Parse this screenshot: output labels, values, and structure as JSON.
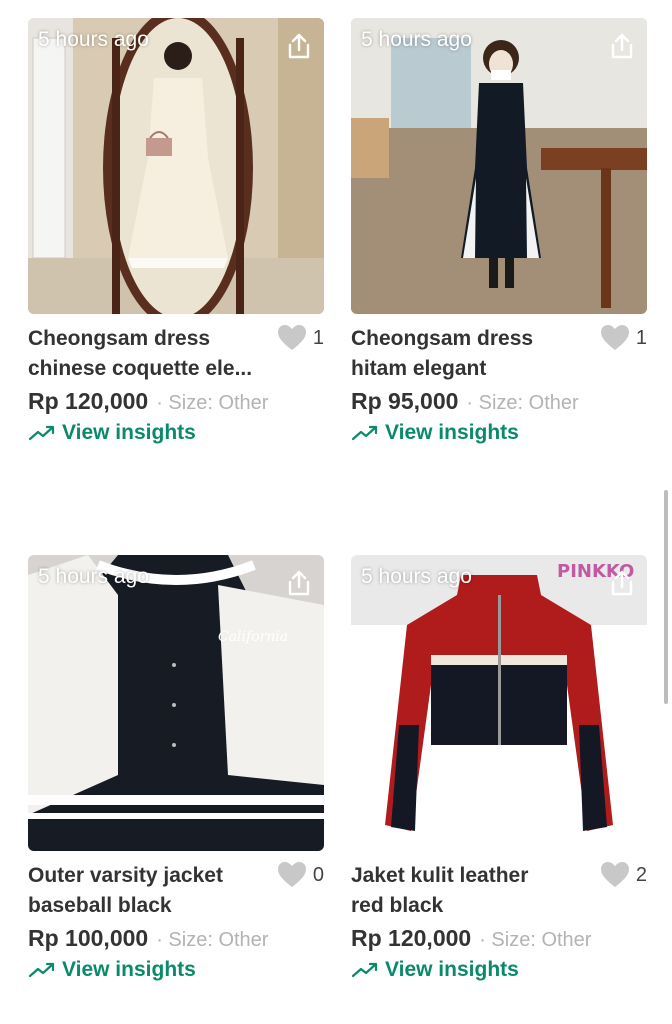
{
  "colors": {
    "accent": "#0b8a6b",
    "text": "#333333",
    "muted": "#b3b3b3",
    "heart": "#c8c8c8"
  },
  "products": [
    {
      "time": "5 hours ago",
      "title_line1": "Cheongsam dress",
      "title_line2": "chinese coquette ele...",
      "likes": "1",
      "price": "Rp 120,000",
      "size": "· Size: Other",
      "insights": "View insights"
    },
    {
      "time": "5 hours ago",
      "title_line1": "Cheongsam dress",
      "title_line2": "hitam elegant",
      "likes": "1",
      "price": "Rp 95,000",
      "size": "· Size: Other",
      "insights": "View insights"
    },
    {
      "time": "5 hours ago",
      "title_line1": "Outer varsity jacket",
      "title_line2": "baseball black",
      "likes": "0",
      "price": "Rp 100,000",
      "size": "· Size: Other",
      "insights": "View insights"
    },
    {
      "time": "5 hours ago",
      "title_line1": "Jaket kulit leather",
      "title_line2": "red black",
      "likes": "2",
      "price": "Rp 120,000",
      "size": "· Size: Other",
      "insights": "View insights",
      "brand_watermark": "PINKKO"
    }
  ]
}
